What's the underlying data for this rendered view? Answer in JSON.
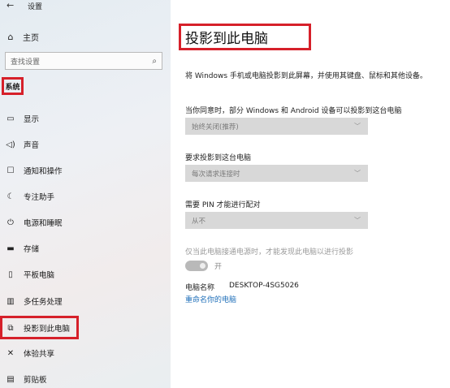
{
  "app": {
    "back": "←",
    "title": "设置"
  },
  "sidebar": {
    "home": {
      "icon": "⌂",
      "label": "主页"
    },
    "search_placeholder": "查找设置",
    "section_label": "系统",
    "items": [
      {
        "name": "display",
        "icon": "▭",
        "label": "显示"
      },
      {
        "name": "sound",
        "icon": "◁)",
        "label": "声音"
      },
      {
        "name": "notifications",
        "icon": "☐",
        "label": "通知和操作"
      },
      {
        "name": "focus-assist",
        "icon": "☾",
        "label": "专注助手"
      },
      {
        "name": "power-sleep",
        "icon": "⏻",
        "label": "电源和睡眠"
      },
      {
        "name": "storage",
        "icon": "▬",
        "label": "存储"
      },
      {
        "name": "tablet",
        "icon": "▯",
        "label": "平板电脑"
      },
      {
        "name": "multitasking",
        "icon": "▥",
        "label": "多任务处理"
      },
      {
        "name": "projecting",
        "icon": "⧉",
        "label": "投影到此电脑"
      },
      {
        "name": "shared-experiences",
        "icon": "✕",
        "label": "体验共享"
      },
      {
        "name": "clipboard",
        "icon": "▤",
        "label": "剪贴板"
      }
    ]
  },
  "main": {
    "title": "投影到此电脑",
    "description": "将 Windows 手机或电脑投影到此屏幕，并使用其键盘、鼠标和其他设备。",
    "field1": {
      "label": "当你同意时，部分 Windows 和 Android 设备可以投影到这台电脑",
      "value": "始终关闭(推荐)"
    },
    "field2": {
      "label": "要求投影到这台电脑",
      "value": "每次请求连接时"
    },
    "field3": {
      "label": "需要 PIN 才能进行配对",
      "value": "从不"
    },
    "hint": "仅当此电脑接通电源时，才能发现此电脑以进行投影",
    "toggle_label": "开",
    "pc_name_label": "电脑名称",
    "pc_name_value": "DESKTOP-4SG5026",
    "rename_link": "重命名你的电脑"
  },
  "colors": {
    "highlight_border": "#d6202a",
    "link": "#1f6fb9",
    "dropdown_bg": "#d8d8d8"
  }
}
